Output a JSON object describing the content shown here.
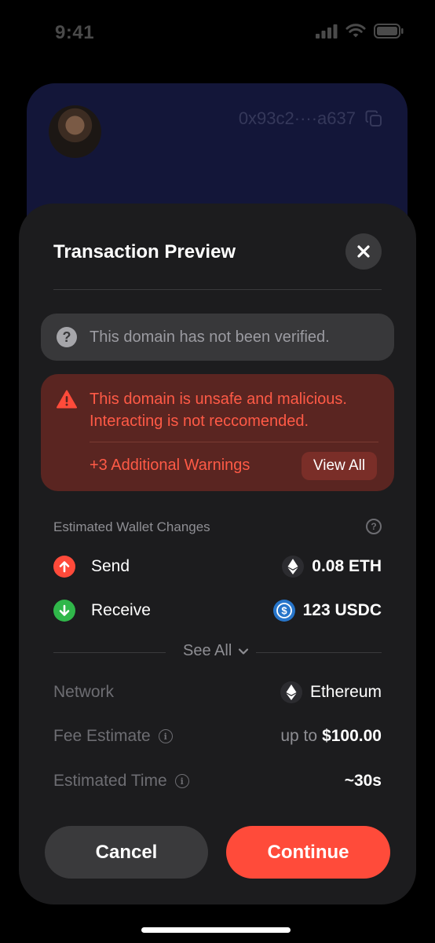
{
  "status_bar": {
    "time": "9:41"
  },
  "background_card": {
    "address": "0x93c2····a637"
  },
  "sheet": {
    "title": "Transaction Preview",
    "verify_banner": {
      "text": "This domain has not been verified."
    },
    "warning": {
      "line1": "This domain is unsafe and malicious.",
      "line2": "Interacting is not reccomended.",
      "additional": "+3 Additional Warnings",
      "view_all_label": "View All"
    },
    "wallet_changes": {
      "label": "Estimated Wallet Changes",
      "send": {
        "label": "Send",
        "value": "0.08 ETH"
      },
      "receive": {
        "label": "Receive",
        "value": "123 USDC"
      }
    },
    "see_all_label": "See All",
    "network": {
      "label": "Network",
      "value": "Ethereum"
    },
    "fee": {
      "label": "Fee Estimate",
      "prefix": "up to",
      "amount": "$100.00"
    },
    "time": {
      "label": "Estimated Time",
      "value": "~30s"
    },
    "buttons": {
      "cancel": "Cancel",
      "continue": "Continue"
    }
  },
  "colors": {
    "accent": "#ff4b3a",
    "send": "#ff4a3a",
    "receive": "#30b74a",
    "warning_bg": "#5a2521",
    "usdc": "#2775ca"
  },
  "icons": {
    "close": "close-icon",
    "question": "question-icon",
    "warning": "warning-triangle-icon",
    "send": "arrow-up-icon",
    "receive": "arrow-down-icon",
    "eth": "ethereum-icon",
    "usdc": "usdc-icon",
    "copy": "copy-icon",
    "chevron": "chevron-down-icon",
    "info": "info-icon"
  }
}
